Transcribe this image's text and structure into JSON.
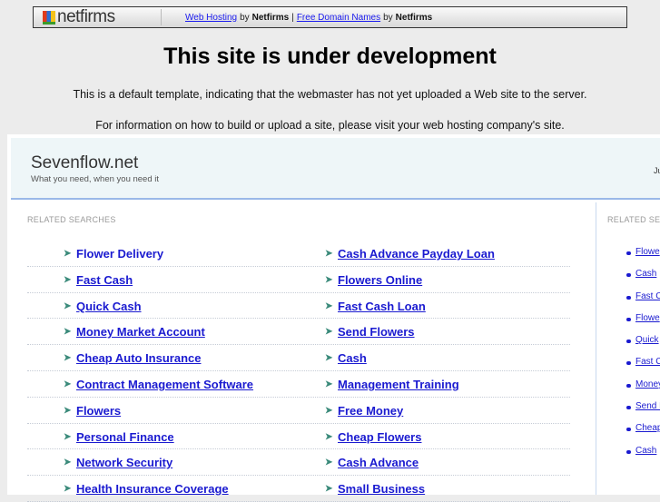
{
  "topbar": {
    "logo": "netfirms",
    "link1": "Web Hosting",
    "by": "by",
    "brand": "Netfirms",
    "pipe": "|",
    "link2": "Free Domain Names"
  },
  "title": "This site is under development",
  "line1": "This is a default template, indicating that the webmaster has not yet uploaded a Web site to the server.",
  "line2": "For information on how to build or upload a site, please visit your web hosting company's site.",
  "site": {
    "name": "Sevenflow.net",
    "tagline": "What you need, when you need it",
    "right_text": "Ju"
  },
  "main": {
    "label": "RELATED SEARCHES",
    "rows": [
      [
        "Flower Delivery",
        "Cash Advance Payday Loan"
      ],
      [
        "Fast Cash",
        "Flowers Online"
      ],
      [
        "Quick Cash",
        "Fast Cash Loan"
      ],
      [
        "Money Market Account",
        "Send Flowers"
      ],
      [
        "Cheap Auto Insurance",
        "Cash"
      ],
      [
        "Contract Management Software",
        "Management Training"
      ],
      [
        "Flowers",
        "Free Money"
      ],
      [
        "Personal Finance",
        "Cheap Flowers"
      ],
      [
        "Network Security",
        "Cash Advance"
      ],
      [
        "Health Insurance Coverage",
        "Small Business"
      ]
    ]
  },
  "sidebar": {
    "label": "RELATED SE",
    "items": [
      "Flowe",
      "Cash ",
      "Fast C",
      "Flowe",
      "Quick",
      "Fast C",
      "Money",
      "Send F",
      "Cheap",
      "Cash"
    ]
  }
}
